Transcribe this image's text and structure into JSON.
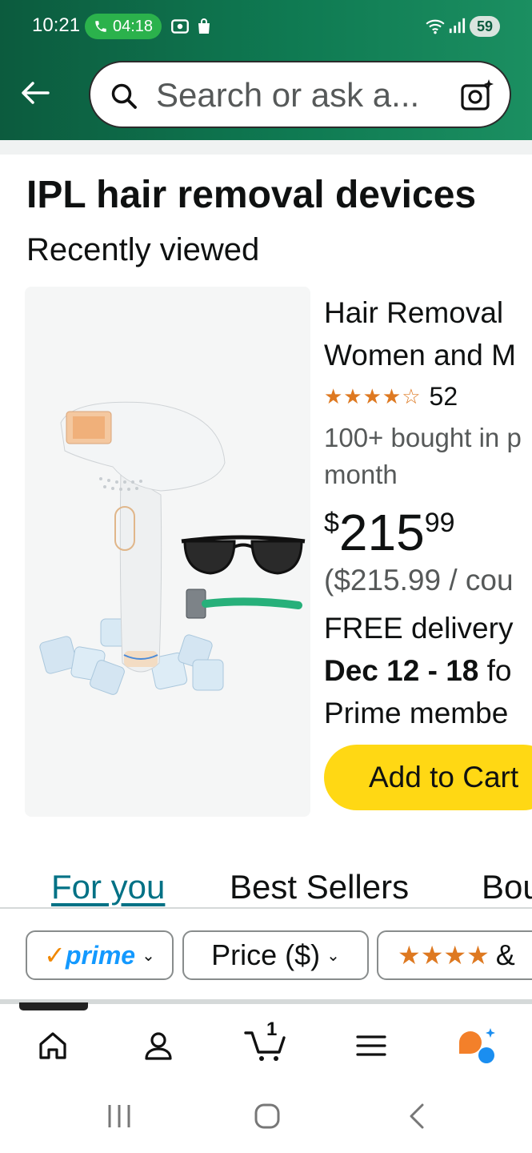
{
  "status_bar": {
    "time": "10:21",
    "call_timer": "04:18",
    "battery": "59",
    "icons": [
      "phone-icon",
      "screenshot-icon",
      "shopping-bag-icon",
      "wifi-icon",
      "signal-icon"
    ]
  },
  "header": {
    "search_placeholder": "Search or ask a...",
    "icons": [
      "back-arrow-icon",
      "search-icon",
      "camera-lens-icon"
    ]
  },
  "page": {
    "title": "IPL hair removal devices",
    "subtitle": "Recently viewed"
  },
  "product": {
    "title_line1": "Hair Removal",
    "title_line2": "Women and M",
    "rating_stars": 4.5,
    "rating_count": "52",
    "bought_line1": "100+ bought in p",
    "bought_line2": "month",
    "price_currency": "$",
    "price_whole": "215",
    "price_fraction": "99",
    "unit_price": "($215.99 / cou",
    "delivery_line1": "FREE delivery",
    "delivery_date": "Dec 12 - 18",
    "delivery_suffix": " fo",
    "delivery_line3": "Prime membe",
    "add_to_cart": "Add to Cart"
  },
  "tabs": [
    {
      "label": "For you",
      "active": true
    },
    {
      "label": "Best Sellers",
      "active": false
    },
    {
      "label": "Bou",
      "active": false
    }
  ],
  "filters": {
    "prime_check": "✓",
    "prime_label": "prime",
    "price_label": "Price ($)",
    "rating_suffix": "&"
  },
  "bottom_nav": {
    "items": [
      "home-icon",
      "account-icon",
      "cart-icon",
      "menu-icon",
      "rufus-icon"
    ],
    "cart_count": "1"
  },
  "colors": {
    "header_green": "#0f7a52",
    "link_teal": "#007185",
    "cart_yellow": "#ffd814",
    "star_orange": "#de7921",
    "prime_blue": "#1399ff"
  }
}
